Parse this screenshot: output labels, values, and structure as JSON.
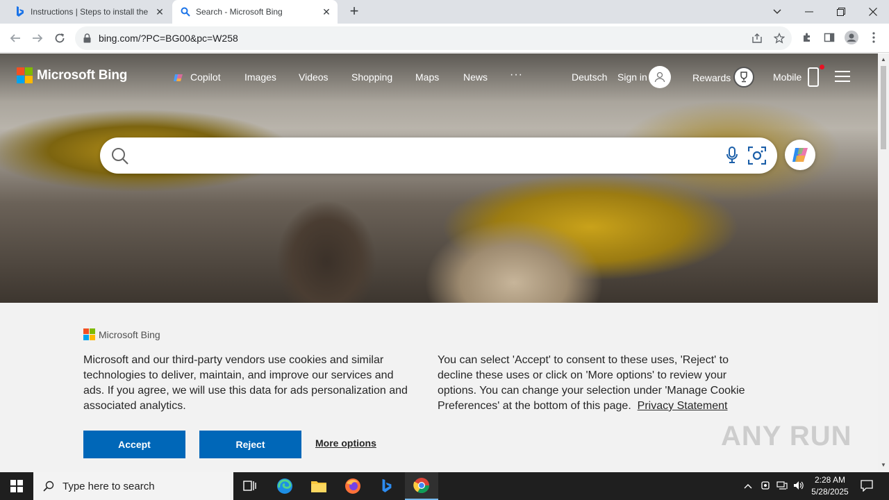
{
  "browser": {
    "tabs": [
      {
        "title": "Instructions | Steps to install the"
      },
      {
        "title": "Search - Microsoft Bing"
      }
    ],
    "url": "bing.com/?PC=BG00&pc=W258"
  },
  "header": {
    "logo_text": "Microsoft Bing",
    "nav": [
      "Copilot",
      "Images",
      "Videos",
      "Shopping",
      "Maps",
      "News"
    ],
    "more": "···",
    "language": "Deutsch",
    "signin": "Sign in",
    "rewards": "Rewards",
    "mobile": "Mobile"
  },
  "search": {
    "placeholder": ""
  },
  "cookie": {
    "logo_text": "Microsoft Bing",
    "left_text": "Microsoft and our third-party vendors use cookies and similar technologies to deliver, maintain, and improve our services and ads. If you agree, we will use this data for ads personalization and associated analytics.",
    "right_text": "You can select 'Accept' to consent to these uses, 'Reject' to decline these uses or click on 'More options' to review your options. You can change your selection under 'Manage Cookie Preferences' at the bottom of this page.",
    "privacy_link": "Privacy Statement",
    "accept": "Accept",
    "reject": "Reject",
    "more_options": "More options"
  },
  "watermark": "ANY RUN",
  "taskbar": {
    "search_text": "Type here to search",
    "time": "2:28 AM",
    "date": "5/28/2025"
  },
  "colors": {
    "accent_button": "#0067b8",
    "taskbar": "#1f1f1f",
    "tabstrip": "#dee1e6"
  }
}
